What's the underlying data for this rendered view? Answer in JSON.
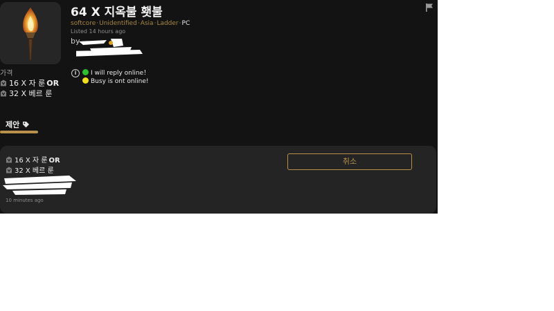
{
  "listing": {
    "title": "64 X 지옥불 횃불",
    "tags": {
      "mode": "softcore",
      "quality": "Unidentified",
      "region": "Asia",
      "ladder": "Ladder",
      "platform": "PC",
      "separator": "·"
    },
    "listed": "Listed 14 hours ago",
    "by_prefix": "by",
    "notes": [
      {
        "color": "#2ec02e",
        "text": "I will reply online！"
      },
      {
        "color": "#f0e020",
        "text": "Busy is ont online!"
      }
    ]
  },
  "price": {
    "label": "가격",
    "lines": [
      {
        "text": "16 X 자 룬",
        "suffix": "OR"
      },
      {
        "text": "32 X 베르 룬",
        "suffix": ""
      }
    ]
  },
  "tab": {
    "label": "제안"
  },
  "offer": {
    "lines": [
      {
        "text": "16 X 자 룬",
        "suffix": "OR"
      },
      {
        "text": "32 X 베르 룬",
        "suffix": ""
      }
    ],
    "cancel_label": "취소",
    "time": "10 minutes ago"
  },
  "colors": {
    "panel": "#131313",
    "card": "#242424",
    "accent": "#b8924a",
    "tag_text": "#a8873e"
  },
  "icons": {
    "flag": "flag-icon",
    "info": "info-icon",
    "tag": "price-tag-icon",
    "rune": "rune-icon",
    "item": "torch-item-image"
  }
}
